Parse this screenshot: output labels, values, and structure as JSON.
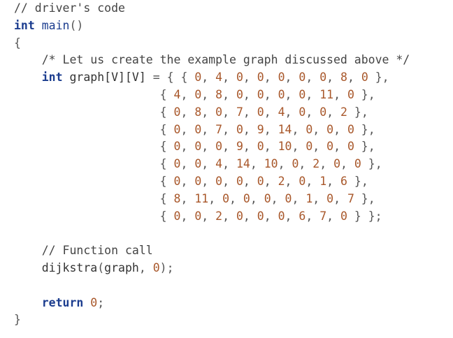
{
  "code": {
    "comment_driver": "// driver's code",
    "int_kw": "int",
    "main_name": "main",
    "main_parens": "()",
    "open_brace": "{",
    "comment_create": "/* Let us create the example graph discussed above */",
    "graph_kw": "int",
    "graph_decl": "graph[V][V]",
    "assign": "=",
    "outer_open": "{",
    "matrix_rows": [
      [
        "0",
        "4",
        "0",
        "0",
        "0",
        "0",
        "0",
        "8",
        "0"
      ],
      [
        "4",
        "0",
        "8",
        "0",
        "0",
        "0",
        "0",
        "11",
        "0"
      ],
      [
        "0",
        "8",
        "0",
        "7",
        "0",
        "4",
        "0",
        "0",
        "2"
      ],
      [
        "0",
        "0",
        "7",
        "0",
        "9",
        "14",
        "0",
        "0",
        "0"
      ],
      [
        "0",
        "0",
        "0",
        "9",
        "0",
        "10",
        "0",
        "0",
        "0"
      ],
      [
        "0",
        "0",
        "4",
        "14",
        "10",
        "0",
        "2",
        "0",
        "0"
      ],
      [
        "0",
        "0",
        "0",
        "0",
        "0",
        "2",
        "0",
        "1",
        "6"
      ],
      [
        "8",
        "11",
        "0",
        "0",
        "0",
        "0",
        "1",
        "0",
        "7"
      ],
      [
        "0",
        "0",
        "2",
        "0",
        "0",
        "0",
        "6",
        "7",
        "0"
      ]
    ],
    "matrix_end": "};",
    "comment_call": "// Function call",
    "call_name": "dijkstra",
    "call_args_open": "(",
    "call_arg_graph": "graph",
    "call_arg_sep": ", ",
    "call_arg_zero": "0",
    "call_args_close": ");",
    "return_kw": "return",
    "return_value": "0",
    "return_end": ";",
    "close_brace": "}"
  },
  "colors": {
    "keyword": "#1c3d8f",
    "number": "#a8572a",
    "comment": "#444444",
    "text": "#333333"
  }
}
